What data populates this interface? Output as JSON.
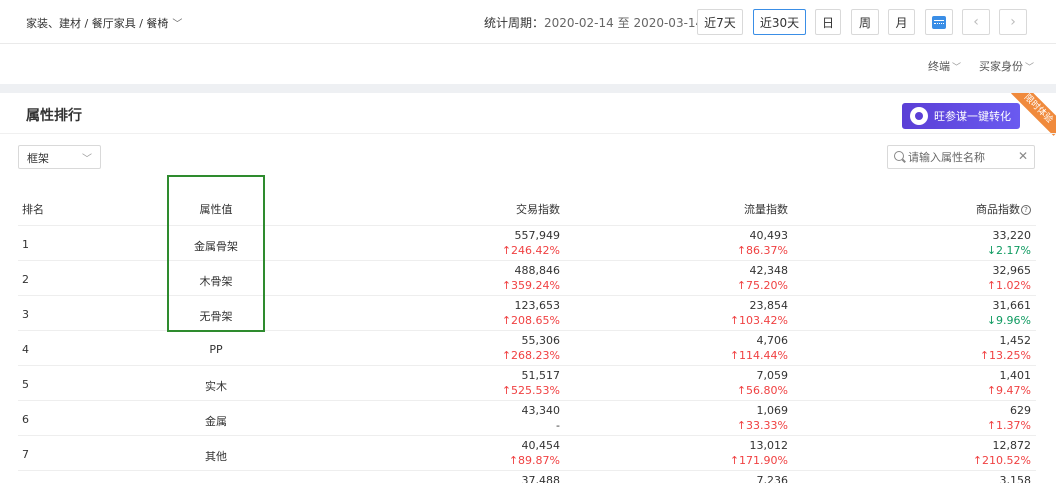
{
  "breadcrumb": "家装、建材 / 餐厅家具 / 餐椅",
  "period": {
    "label": "统计周期：",
    "start": "2020-02-14",
    "sep": "至",
    "end": "2020-03-14"
  },
  "buttons": {
    "last7": "近7天",
    "last30": "近30天",
    "day": "日",
    "week": "周",
    "month": "月",
    "prev": "‹",
    "next": "›"
  },
  "filters": {
    "terminal": "终端",
    "buyer": "买家身份"
  },
  "panel": {
    "title": "属性排行",
    "promo": "旺参谋一键转化",
    "ribbon": "限时体验",
    "select_value": "框架",
    "search_placeholder": "请输入属性名称"
  },
  "table": {
    "headers": {
      "rank": "排名",
      "attr": "属性值",
      "trade": "交易指数",
      "flow": "流量指数",
      "goods": "商品指数"
    },
    "rows": [
      {
        "rank": "1",
        "attr": "金属骨架",
        "trade": "557,949",
        "trade_chg": "246.42%",
        "trade_dir": "up",
        "flow": "40,493",
        "flow_chg": "86.37%",
        "flow_dir": "up",
        "goods": "33,220",
        "goods_chg": "2.17%",
        "goods_dir": "down"
      },
      {
        "rank": "2",
        "attr": "木骨架",
        "trade": "488,846",
        "trade_chg": "359.24%",
        "trade_dir": "up",
        "flow": "42,348",
        "flow_chg": "75.20%",
        "flow_dir": "up",
        "goods": "32,965",
        "goods_chg": "1.02%",
        "goods_dir": "up"
      },
      {
        "rank": "3",
        "attr": "无骨架",
        "trade": "123,653",
        "trade_chg": "208.65%",
        "trade_dir": "up",
        "flow": "23,854",
        "flow_chg": "103.42%",
        "flow_dir": "up",
        "goods": "31,661",
        "goods_chg": "9.96%",
        "goods_dir": "down"
      },
      {
        "rank": "4",
        "attr": "PP",
        "trade": "55,306",
        "trade_chg": "268.23%",
        "trade_dir": "up",
        "flow": "4,706",
        "flow_chg": "114.44%",
        "flow_dir": "up",
        "goods": "1,452",
        "goods_chg": "13.25%",
        "goods_dir": "up"
      },
      {
        "rank": "5",
        "attr": "实木",
        "trade": "51,517",
        "trade_chg": "525.53%",
        "trade_dir": "up",
        "flow": "7,059",
        "flow_chg": "56.80%",
        "flow_dir": "up",
        "goods": "1,401",
        "goods_chg": "9.47%",
        "goods_dir": "up"
      },
      {
        "rank": "6",
        "attr": "金属",
        "trade": "43,340",
        "trade_chg": "-",
        "trade_dir": "none",
        "flow": "1,069",
        "flow_chg": "33.33%",
        "flow_dir": "up",
        "goods": "629",
        "goods_chg": "1.37%",
        "goods_dir": "up"
      },
      {
        "rank": "7",
        "attr": "其他",
        "trade": "40,454",
        "trade_chg": "89.87%",
        "trade_dir": "up",
        "flow": "13,012",
        "flow_chg": "171.90%",
        "flow_dir": "up",
        "goods": "12,872",
        "goods_chg": "210.52%",
        "goods_dir": "up"
      },
      {
        "rank": "",
        "attr": "",
        "trade": "37,488",
        "trade_chg": "",
        "trade_dir": "none",
        "flow": "7,236",
        "flow_chg": "",
        "flow_dir": "none",
        "goods": "3,158",
        "goods_chg": "",
        "goods_dir": "none"
      }
    ]
  },
  "colors": {
    "accent": "#3a8ee6",
    "up": "#f04142",
    "down": "#0e9a60",
    "highlight": "#2e8b2e",
    "promo": "#5b3fd6",
    "ribbon": "#f08a3c"
  }
}
